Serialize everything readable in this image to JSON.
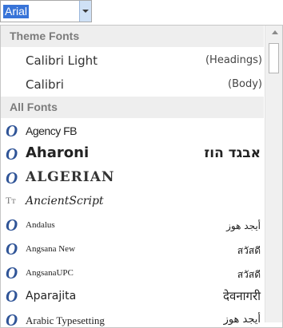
{
  "combo": {
    "value": "Arial"
  },
  "sections": {
    "theme": "Theme Fonts",
    "all": "All Fonts"
  },
  "theme_fonts": [
    {
      "name": "Calibri Light",
      "tag": "(Headings)"
    },
    {
      "name": "Calibri",
      "tag": "(Body)"
    }
  ],
  "all_fonts": [
    {
      "name": "Agency FB",
      "icon": "opentype-icon",
      "sample": ""
    },
    {
      "name": "Aharoni",
      "icon": "opentype-icon",
      "sample": "אבגד הוז"
    },
    {
      "name": "ALGERIAN",
      "icon": "opentype-icon",
      "sample": ""
    },
    {
      "name": "AncientScript",
      "icon": "truetype-icon",
      "sample": ""
    },
    {
      "name": "Andalus",
      "icon": "opentype-icon",
      "sample": "أيجد هوز"
    },
    {
      "name": "Angsana New",
      "icon": "opentype-icon",
      "sample": "สวัสดี"
    },
    {
      "name": "AngsanaUPC",
      "icon": "opentype-icon",
      "sample": "สวัสดี"
    },
    {
      "name": "Aparajita",
      "icon": "opentype-icon",
      "sample": "देवनागरी"
    },
    {
      "name": "Arabic Typesetting",
      "icon": "opentype-icon",
      "sample": "أيجد هوز"
    }
  ],
  "icons": {
    "opentype_glyph": "O",
    "truetype_glyph": "Tᴛ"
  },
  "colors": {
    "selection": "#3874d8",
    "header_bg": "#eeeeee",
    "opentype_icon": "#2f5497"
  }
}
